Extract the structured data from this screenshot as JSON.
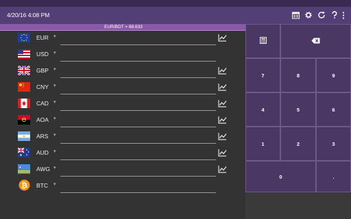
{
  "status": {
    "datetime": "4/20/16 4:08 PM"
  },
  "rate": {
    "text": "EUR/BDT = 88.633"
  },
  "toolbar": {
    "icons": [
      "save-icon",
      "gear-icon",
      "refresh-icon",
      "help-icon",
      "more-vert-icon"
    ]
  },
  "currencies": [
    {
      "code": "EUR",
      "chart": true
    },
    {
      "code": "USD",
      "chart": false
    },
    {
      "code": "GBP",
      "chart": true
    },
    {
      "code": "CNY",
      "chart": true
    },
    {
      "code": "CAD",
      "chart": true
    },
    {
      "code": "AOA",
      "chart": true
    },
    {
      "code": "ARS",
      "chart": true
    },
    {
      "code": "AUD",
      "chart": true
    },
    {
      "code": "AWG",
      "chart": true
    },
    {
      "code": "BTC",
      "chart": false
    }
  ],
  "keypad": {
    "calc_icon": "calculator-icon",
    "backspace_icon": "backspace-icon",
    "keys": [
      "7",
      "8",
      "9",
      "4",
      "5",
      "6",
      "1",
      "2",
      "3",
      "0",
      "."
    ]
  },
  "colors": {
    "toolbar": "#533e76",
    "ratebar": "#8b57a8",
    "keys": "#4a3763",
    "background": "#333333"
  }
}
